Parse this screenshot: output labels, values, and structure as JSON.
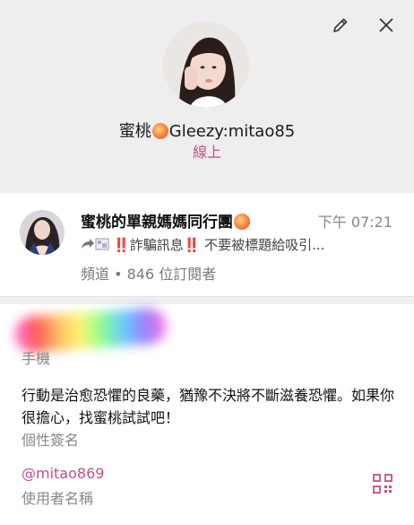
{
  "profile": {
    "name_prefix": "蜜桃",
    "name_suffix": "Gleezy:mitao85",
    "status": "線上"
  },
  "channel": {
    "title_prefix": "蜜桃的單親媽媽同行團",
    "time": "下午 07:21",
    "message_bang1": "‼️",
    "message_text": "詐騙訊息",
    "message_bang2": "‼️",
    "message_tail": " 不要被標題給吸引...",
    "meta": "頻道 • 846 位訂閱者"
  },
  "phone": {
    "label": "手機"
  },
  "bio": {
    "text": "行動是治愈恐懼的良藥，猶豫不決將不斷滋養恐懼。如果你很擔心，找蜜桃試試吧！",
    "label": "個性簽名"
  },
  "username": {
    "value": "@mitao869",
    "label": "使用者名稱"
  },
  "colors": {
    "accent": "#c0508a",
    "header_bg": "#eeeeee"
  },
  "icons": {
    "edit": "pencil-icon",
    "close": "close-icon",
    "qr": "qr-code-icon",
    "forward": "forward-arrow-icon"
  }
}
